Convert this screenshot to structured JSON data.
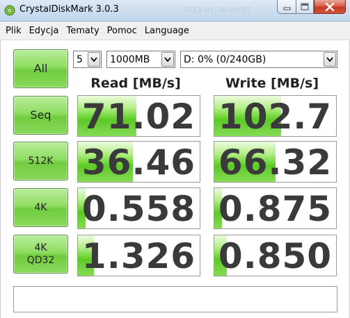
{
  "window": {
    "title": "CrystalDiskMark 3.0.3",
    "title_ghost": "2013-01-26 09:52",
    "app_icon": "crystal-disk-icon"
  },
  "menu": {
    "items": [
      "Plik",
      "Edycja",
      "Tematy",
      "Pomoc",
      "Language"
    ]
  },
  "controls": {
    "all_label": "All",
    "count_value": "5",
    "size_value": "1000MB",
    "drive_value": "D: 0% (0/240GB)"
  },
  "headers": {
    "read": "Read [MB/s]",
    "write": "Write [MB/s]"
  },
  "tests": [
    {
      "label": "Seq",
      "label2": "",
      "read": "71.02",
      "write": "102.7",
      "read_bar": 0.48,
      "write_bar": 0.55
    },
    {
      "label": "512K",
      "label2": "",
      "read": "36.46",
      "write": "66.32",
      "read_bar": 0.45,
      "write_bar": 0.5
    },
    {
      "label": "4K",
      "label2": "",
      "read": "0.558",
      "write": "0.875",
      "read_bar": 0.06,
      "write_bar": 0.06
    },
    {
      "label": "4K",
      "label2": "QD32",
      "read": "1.326",
      "write": "0.850",
      "read_bar": 0.13,
      "write_bar": 0.1
    }
  ],
  "comment": "",
  "colors": {
    "accent_green": "#71cc3e",
    "value_text": "#3a3a3a"
  }
}
